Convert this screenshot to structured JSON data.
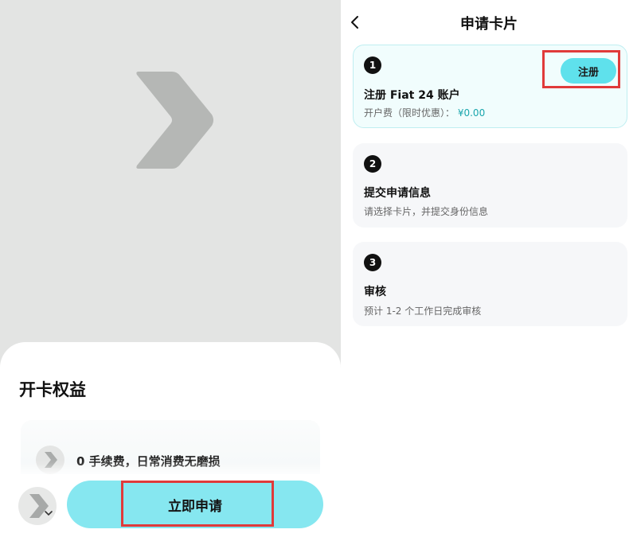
{
  "left": {
    "sheet_title": "开卡权益",
    "benefit": "0 手续费，日常消费无磨损",
    "apply_button_label": "立即申请"
  },
  "right": {
    "page_title": "申请卡片",
    "register_button_label": "注册",
    "steps": [
      {
        "number": "1",
        "title": "注册 Fiat 24 账户",
        "subtitle_label": "开户费（限时优惠）：",
        "subtitle_value": "¥0.00",
        "active": true
      },
      {
        "number": "2",
        "title": "提交申请信息",
        "subtitle": "请选择卡片，并提交身份信息"
      },
      {
        "number": "3",
        "title": "审核",
        "subtitle": "预计 1-2 个工作日完成审核"
      }
    ]
  },
  "colors": {
    "accent_cyan": "#86e7f0",
    "register_cyan": "#5fe1ec",
    "highlight_red": "#e03a3a",
    "fee_teal": "#1aa6ad"
  },
  "icons": {
    "back": "chevron-left-icon",
    "brand": "chevron-right-logo-icon",
    "dropdown": "chevron-down-icon"
  }
}
